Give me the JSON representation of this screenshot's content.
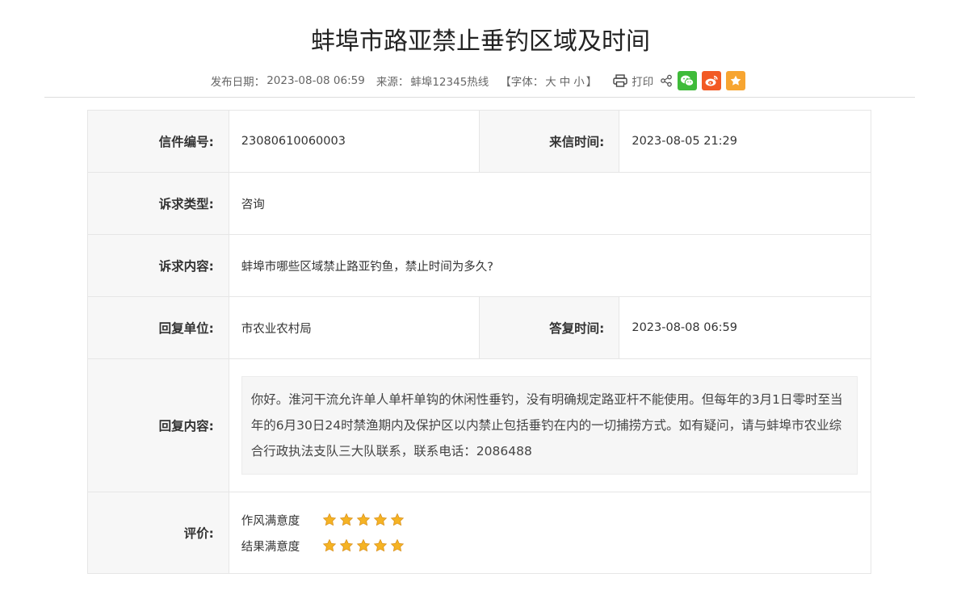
{
  "page": {
    "title": "蚌埠市路亚禁止垂钓区域及时间"
  },
  "meta": {
    "publish_label": "发布日期：",
    "publish_date": "2023-08-08 06:59",
    "source_label": "来源：",
    "source": "蚌埠12345热线",
    "font_label": "【字体：",
    "font_large": "大",
    "font_medium": "中",
    "font_small": "小",
    "font_close": "】",
    "print_label": "打印",
    "share_colors": {
      "wechat": "#3fbb3a",
      "weibo": "#f25a24",
      "favorite": "#f7a531"
    }
  },
  "letter": {
    "number_label": "信件编号:",
    "number_value": "23080610060003",
    "time_label": "来信时间:",
    "time_value": "2023-08-05 21:29",
    "type_label": "诉求类型:",
    "type_value": "咨询",
    "content_label": "诉求内容:",
    "content_value": "蚌埠市哪些区域禁止路亚钓鱼，禁止时间为多久?",
    "reply_unit_label": "回复单位:",
    "reply_unit_value": "市农业农村局",
    "reply_time_label": "答复时间:",
    "reply_time_value": "2023-08-08 06:59",
    "reply_content_label": "回复内容:",
    "reply_content_value": "你好。淮河干流允许单人单杆单钩的休闲性垂钓，没有明确规定路亚杆不能使用。但每年的3月1日零时至当年的6月30日24时禁渔期内及保护区以内禁止包括垂钓在内的一切捕捞方式。如有疑问，请与蚌埠市农业综合行政执法支队三大队联系，联系电话：2086488",
    "rating_label": "评价:",
    "ratings": [
      {
        "label": "作风满意度",
        "stars": 5
      },
      {
        "label": "结果满意度",
        "stars": 5
      }
    ]
  }
}
